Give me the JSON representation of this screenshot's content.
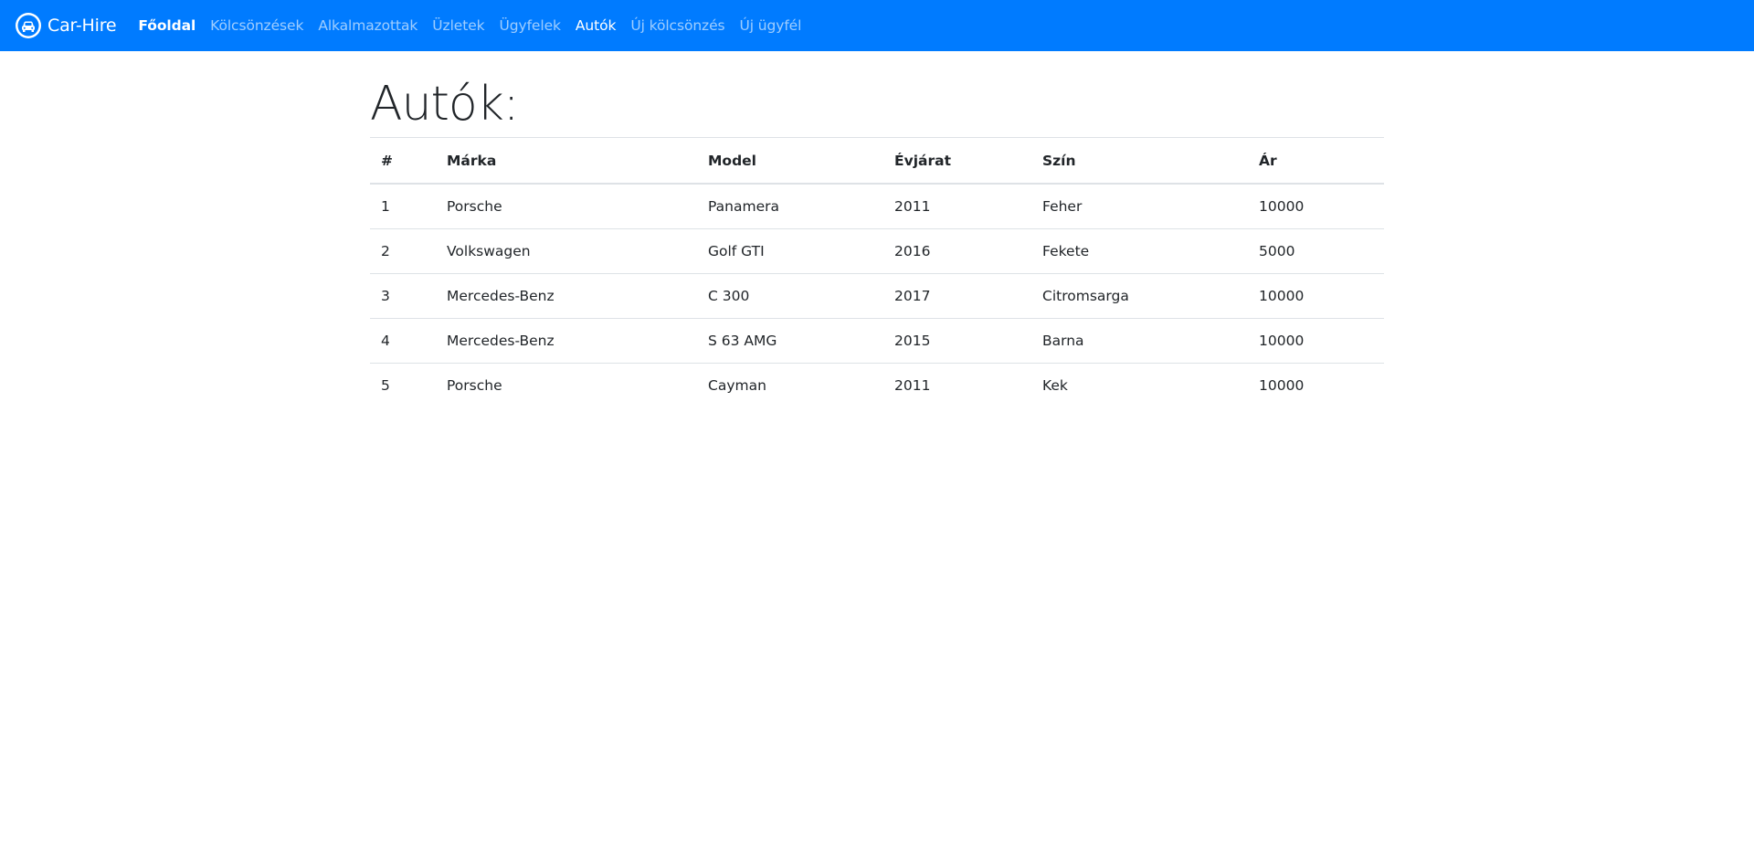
{
  "navbar": {
    "brand_label": "Car-Hire",
    "brand_color": "#007bff",
    "items": [
      {
        "label": "Főoldal",
        "state": "strong"
      },
      {
        "label": "Kölcsönzések",
        "state": "normal"
      },
      {
        "label": "Alkalmazottak",
        "state": "normal"
      },
      {
        "label": "Üzletek",
        "state": "normal"
      },
      {
        "label": "Ügyfelek",
        "state": "normal"
      },
      {
        "label": "Autók",
        "state": "active"
      },
      {
        "label": "Új kölcsönzés",
        "state": "normal"
      },
      {
        "label": "Új ügyfél",
        "state": "normal"
      }
    ]
  },
  "page": {
    "title": "Autók:"
  },
  "table": {
    "headers": [
      "#",
      "Márka",
      "Model",
      "Évjárat",
      "Szín",
      "Ár"
    ],
    "rows": [
      [
        "1",
        "Porsche",
        "Panamera",
        "2011",
        "Feher",
        "10000"
      ],
      [
        "2",
        "Volkswagen",
        "Golf GTI",
        "2016",
        "Fekete",
        "5000"
      ],
      [
        "3",
        "Mercedes-Benz",
        "C 300",
        "2017",
        "Citromsarga",
        "10000"
      ],
      [
        "4",
        "Mercedes-Benz",
        "S 63 AMG",
        "2015",
        "Barna",
        "10000"
      ],
      [
        "5",
        "Porsche",
        "Cayman",
        "2011",
        "Kek",
        "10000"
      ]
    ]
  }
}
